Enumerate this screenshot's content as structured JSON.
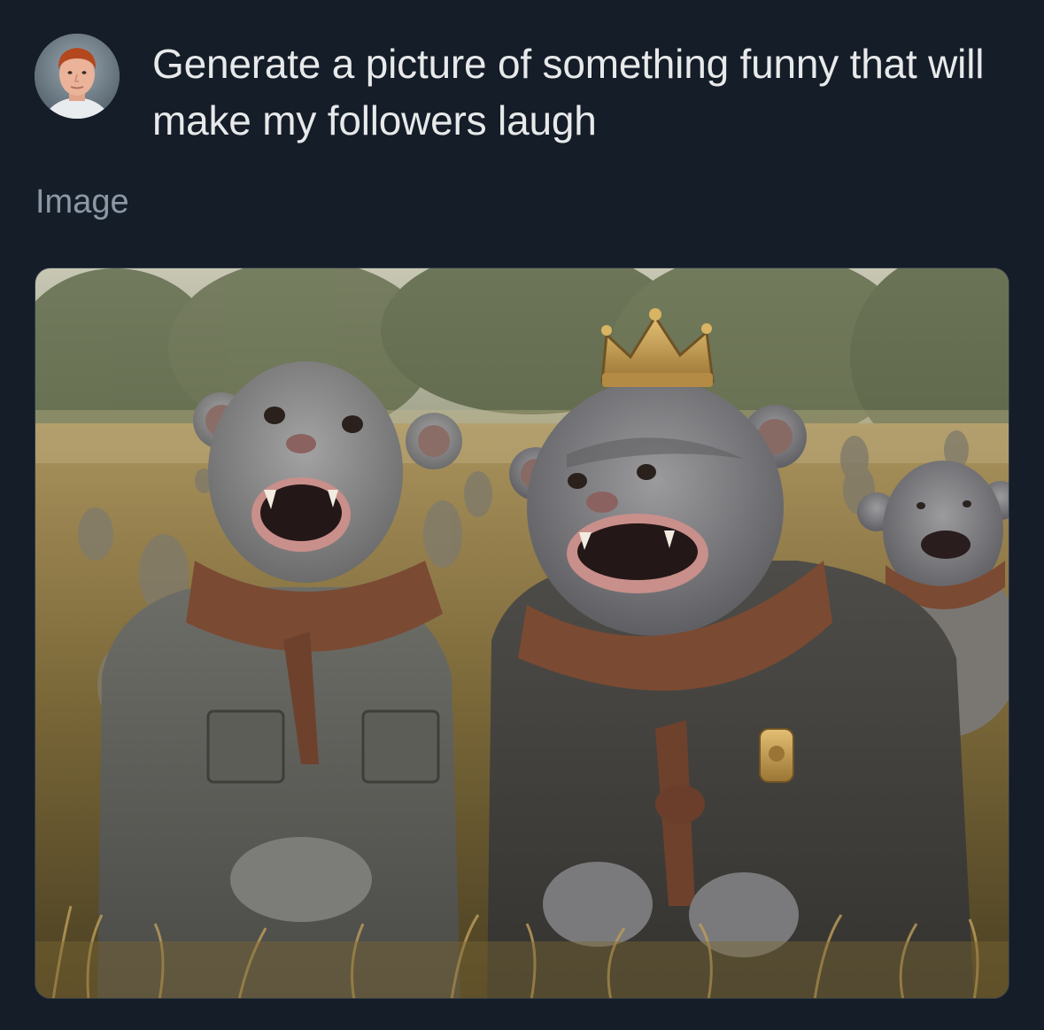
{
  "post": {
    "prompt": "Generate a picture of something funny that will make my followers laugh"
  },
  "media": {
    "label": "Image"
  }
}
